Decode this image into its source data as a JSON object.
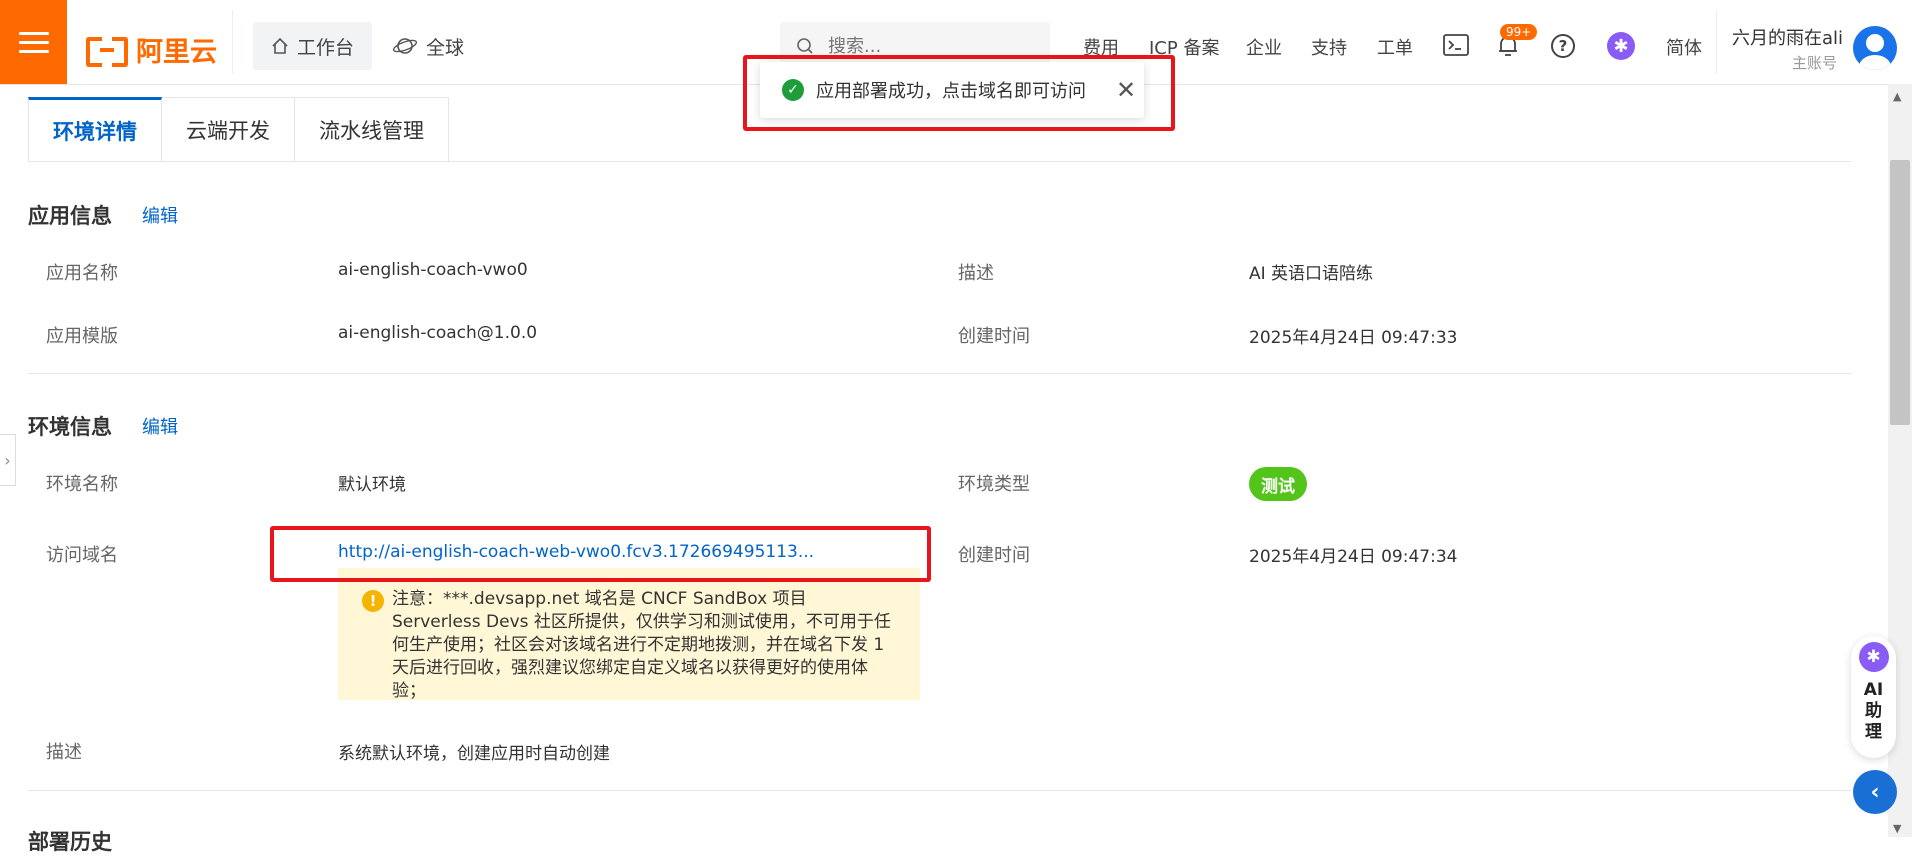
{
  "header": {
    "logo_text": "阿里云",
    "workbench": "工作台",
    "global": "全球",
    "search_placeholder": "搜索...",
    "nav": [
      "费用",
      "ICP 备案",
      "企业",
      "支持",
      "工单"
    ],
    "notification_count": "99+",
    "language": "简体",
    "user_name": "六月的雨在ali",
    "user_role": "主账号"
  },
  "toast": {
    "message": "应用部署成功，点击域名即可访问"
  },
  "tabs": [
    "环境详情",
    "云端开发",
    "流水线管理"
  ],
  "app_info": {
    "title": "应用信息",
    "edit": "编辑",
    "name_label": "应用名称",
    "name_value": "ai-english-coach-vwo0",
    "desc_label": "描述",
    "desc_value": "AI 英语口语陪练",
    "template_label": "应用模版",
    "template_value": "ai-english-coach@1.0.0",
    "created_label": "创建时间",
    "created_value": "2025年4月24日 09:47:33"
  },
  "env_info": {
    "title": "环境信息",
    "edit": "编辑",
    "name_label": "环境名称",
    "name_value": "默认环境",
    "type_label": "环境类型",
    "type_value": "测试",
    "domain_label": "访问域名",
    "domain_value": "http://ai-english-coach-web-vwo0.fcv3.172669495113...",
    "created_label": "创建时间",
    "created_value": "2025年4月24日 09:47:34",
    "notice": "注意：***.devsapp.net 域名是 CNCF SandBox 项目 Serverless Devs 社区所提供，仅供学习和测试使用，不可用于任何生产使用；社区会对该域名进行不定期地拨测，并在域名下发 1 天后进行回收，强烈建议您绑定自定义域名以获得更好的使用体验；",
    "desc_label": "描述",
    "desc_value": "系统默认环境，创建应用时自动创建"
  },
  "next_section": "部署历史",
  "ai_assistant": "AI助理"
}
